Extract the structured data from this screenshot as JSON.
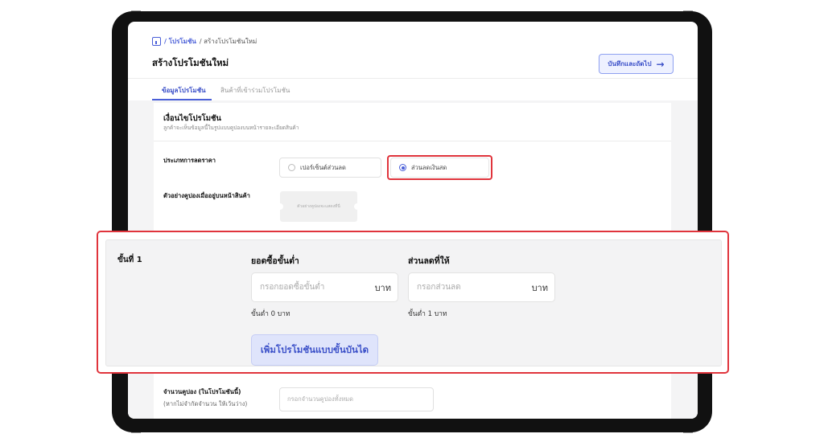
{
  "breadcrumb": {
    "home_icon": "store-icon",
    "link": "/ โปรโมชัน",
    "current": "/ สร้างโปรโมชันใหม่"
  },
  "header": {
    "title": "สร้างโปรโมชันใหม่",
    "save_label": "บันทึกและถัดไป",
    "save_icon": "→"
  },
  "tabs": [
    {
      "label": "ข้อมูลโปรโมชัน",
      "active": true
    },
    {
      "label": "สินค้าที่เข้าร่วมโปรโมชัน",
      "active": false
    }
  ],
  "conditions": {
    "title": "เงื่อนไขโปรโมชัน",
    "subtitle": "ลูกค้าจะเห็นข้อมูลนี้ในรูปแบบคูปองบนหน้ารายละเอียดสินค้า",
    "discount_type_label": "ประเภทการลดราคา",
    "options": [
      {
        "label": "เปอร์เซ็นต์ส่วนลด",
        "selected": false
      },
      {
        "label": "ส่วนลดเงินสด",
        "selected": true
      }
    ],
    "preview_label": "ตัวอย่างคูปองเมื่ออยู่บนหน้าสินค้า",
    "preview_coupon_text": "ตัวอย่างคูปองจะแสดงที่นี่"
  },
  "tier": {
    "step_label": "ขั้นที่ 1",
    "min_purchase_label": "ยอดซื้อขั้นต่ำ",
    "min_purchase_placeholder": "กรอกยอดซื้อขั้นต่ำ",
    "min_purchase_unit": "บาท",
    "min_purchase_hint": "ขั้นต่ำ 0 บาท",
    "discount_label": "ส่วนลดที่ให้",
    "discount_placeholder": "กรอกส่วนลด",
    "discount_unit": "บาท",
    "discount_hint": "ขั้นต่ำ 1 บาท",
    "add_tier_label": "เพิ่มโปรโมชันแบบขั้นบันได"
  },
  "quantity": {
    "label": "จำนวนคูปอง (ในโปรโมชันนี้)",
    "sublabel": "(หากไม่จำกัดจำนวน ให้เว้นว่าง)",
    "placeholder": "กรอกจำนวนคูปองทั้งหมด"
  },
  "colors": {
    "accent": "#4a5fd8",
    "highlight": "#e0343c"
  }
}
